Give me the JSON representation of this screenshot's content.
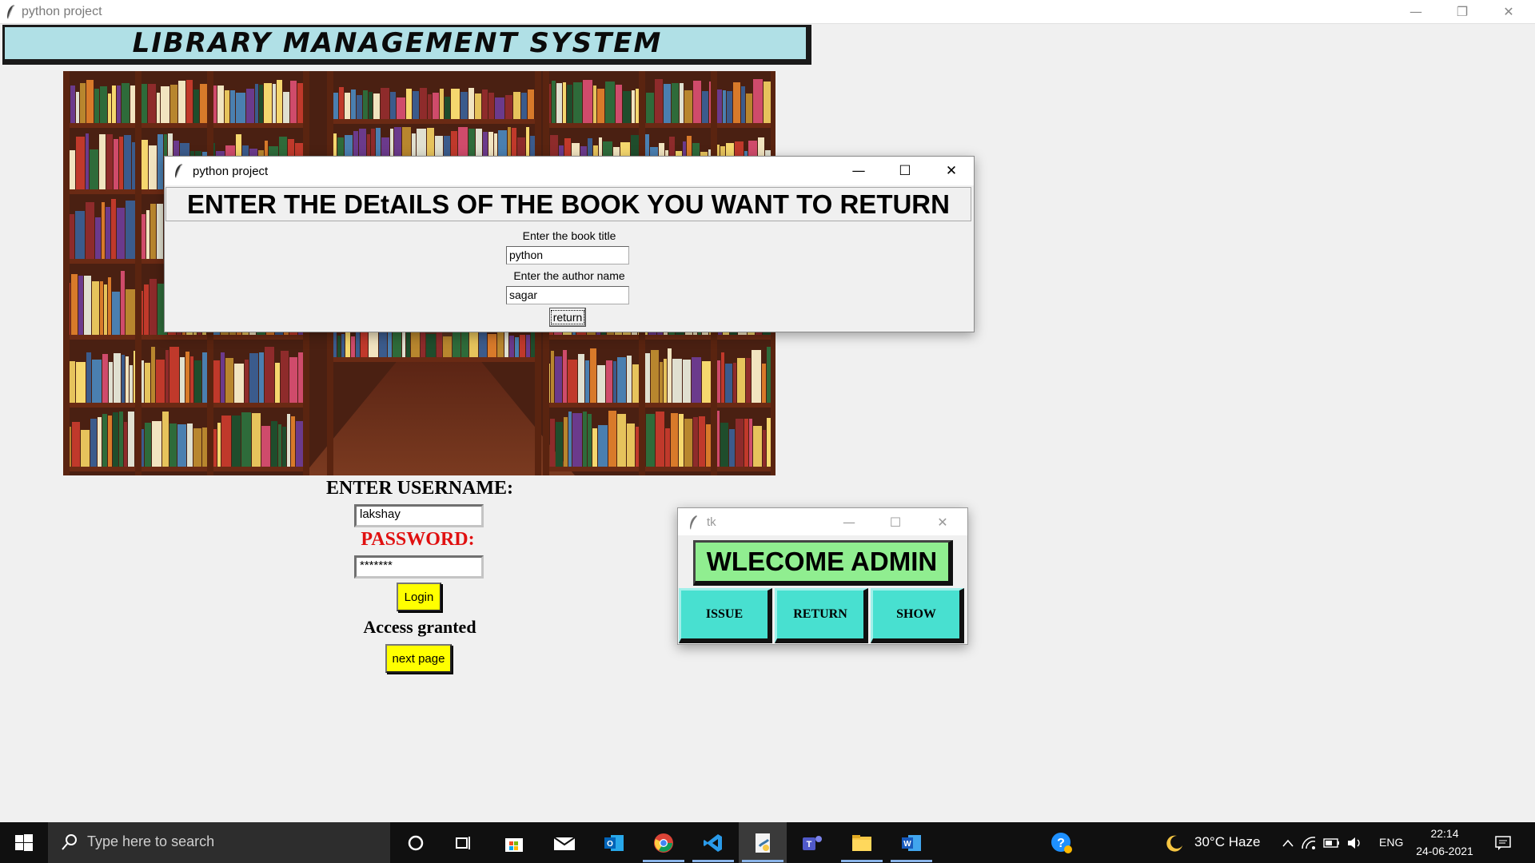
{
  "main_window": {
    "title": "python project",
    "controls": {
      "minimize": "—",
      "restore": "❐",
      "close": "✕"
    }
  },
  "banner": {
    "title": "LIBRARY MANAGEMENT SYSTEM"
  },
  "login": {
    "username_label": "ENTER USERNAME:",
    "username_value": "lakshay",
    "password_label": "PASSWORD:",
    "password_value": "*******",
    "login_button": "Login",
    "status": "Access granted",
    "next_button": "next page"
  },
  "return_dialog": {
    "title": "python project",
    "heading": "ENTER THE DEtAILS OF THE BOOK YOU WANT TO RETURN",
    "book_title_label": "Enter the book title",
    "book_title_value": "python",
    "author_label": "Enter the author name",
    "author_value": "sagar",
    "return_button": "return",
    "controls": {
      "minimize": "—",
      "maximize": "☐",
      "close": "✕"
    }
  },
  "admin_window": {
    "title": "tk",
    "welcome": "WLECOME ADMIN",
    "buttons": [
      "ISSUE",
      "RETURN",
      "SHOW"
    ],
    "controls": {
      "minimize": "—",
      "maximize": "☐",
      "close": "✕"
    }
  },
  "taskbar": {
    "search_placeholder": "Type here to search",
    "weather": "30°C  Haze",
    "language": "ENG",
    "time": "22:14",
    "date": "24-06-2021",
    "colors": {
      "accent_teal": "#48e0d0",
      "welcome_green": "#90ee90",
      "banner_blue": "#b0e0e6",
      "yellow": "#ffff00"
    }
  }
}
